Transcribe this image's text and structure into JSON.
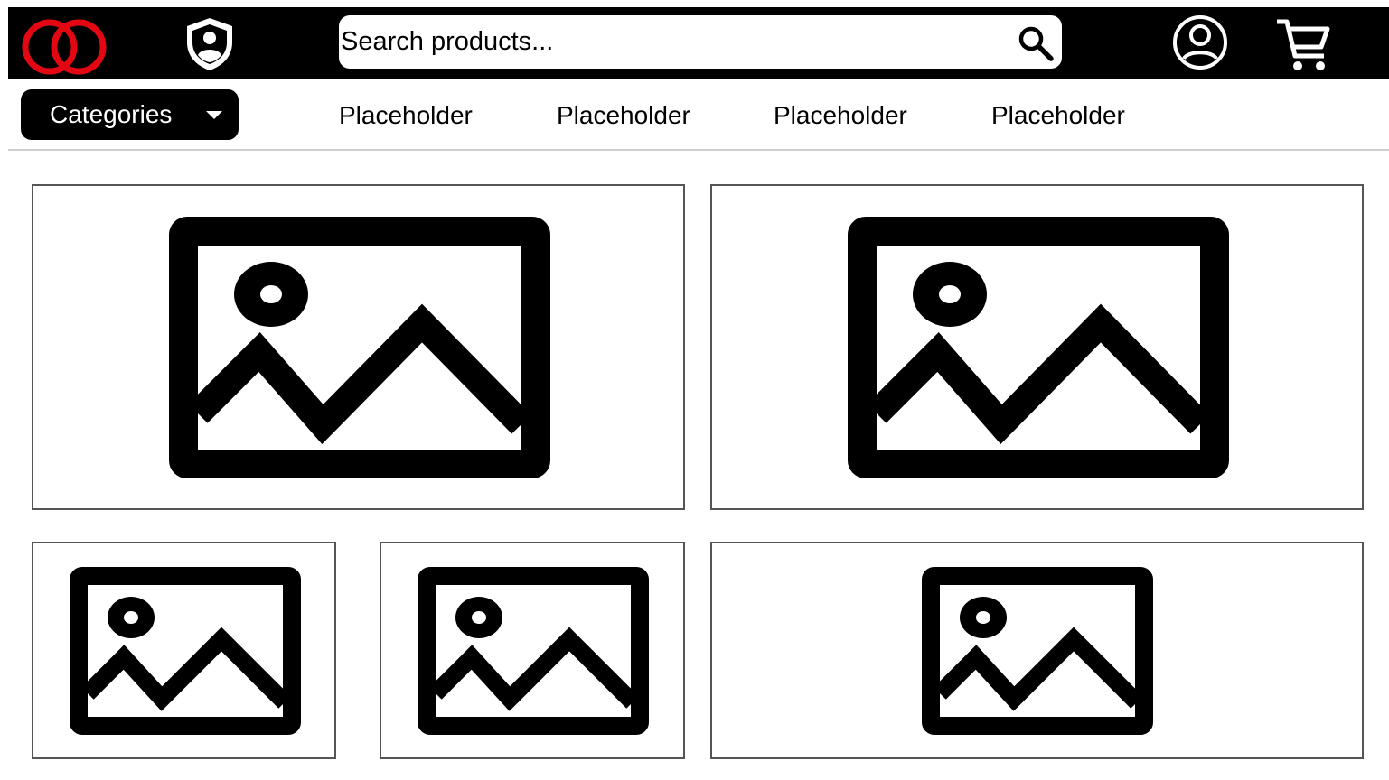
{
  "header": {
    "logo_icon": "interlocking-red-rings-logo",
    "shield_icon": "shield-user-icon",
    "search": {
      "placeholder": "Search products...",
      "value": "",
      "icon": "search-icon"
    },
    "account_icon": "user-circle-icon",
    "cart_icon": "shopping-cart-icon",
    "brand_color": "#e30613"
  },
  "nav": {
    "categories_label": "Categories",
    "categories_icon": "caret-down-icon",
    "links": [
      "Placeholder",
      "Placeholder",
      "Placeholder",
      "Placeholder"
    ]
  },
  "grid": {
    "cards": [
      {
        "name": "image-placeholder-1",
        "icon": "image-placeholder-icon"
      },
      {
        "name": "image-placeholder-2",
        "icon": "image-placeholder-icon"
      },
      {
        "name": "image-placeholder-3",
        "icon": "image-placeholder-icon"
      },
      {
        "name": "image-placeholder-4",
        "icon": "image-placeholder-icon"
      },
      {
        "name": "image-placeholder-5",
        "icon": "image-placeholder-icon"
      }
    ]
  }
}
